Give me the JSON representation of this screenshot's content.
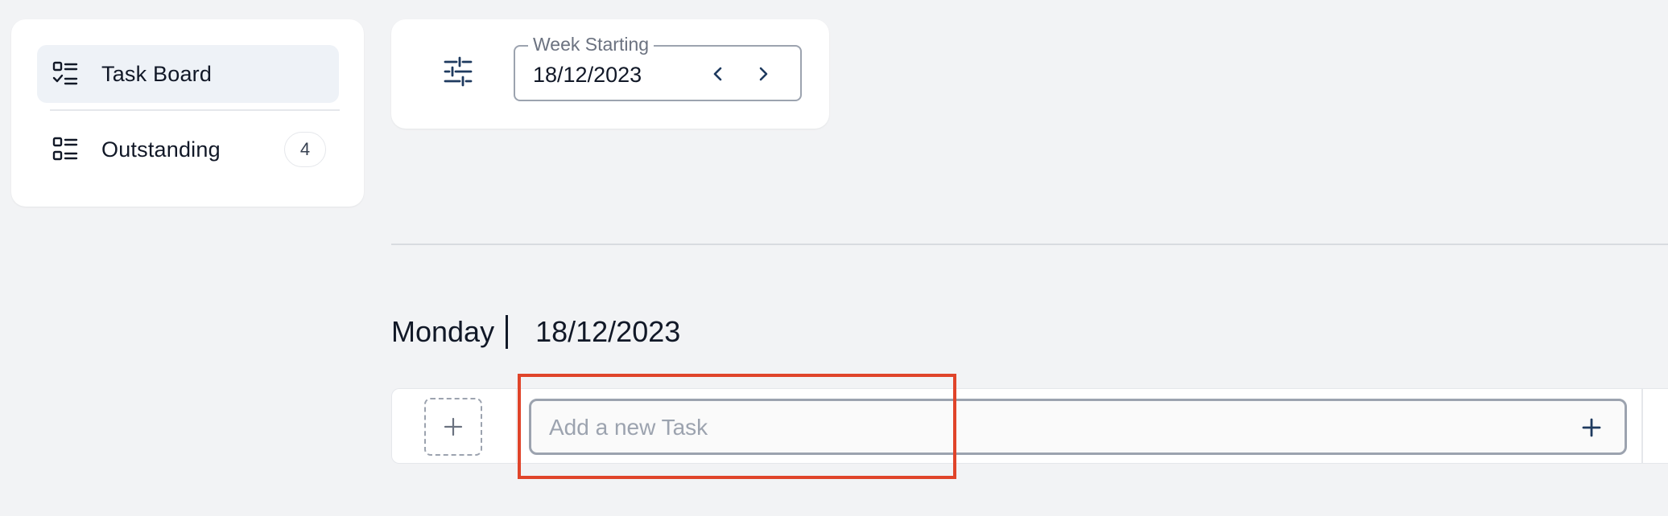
{
  "sidebar": {
    "items": [
      {
        "label": "Task Board",
        "icon": "task-board-icon",
        "active": true
      },
      {
        "label": "Outstanding",
        "icon": "outstanding-list-icon",
        "badge": "4"
      }
    ]
  },
  "filters": {
    "icon": "filter-sliders-icon",
    "week_label": "Week Starting",
    "week_value": "18/12/2023"
  },
  "day": {
    "name": "Monday",
    "date": "18/12/2023"
  },
  "task_input": {
    "placeholder": "Add a new Task",
    "value": ""
  },
  "colors": {
    "background": "#f2f3f5",
    "accent": "#1e3a5f",
    "highlight": "#e0442a"
  }
}
